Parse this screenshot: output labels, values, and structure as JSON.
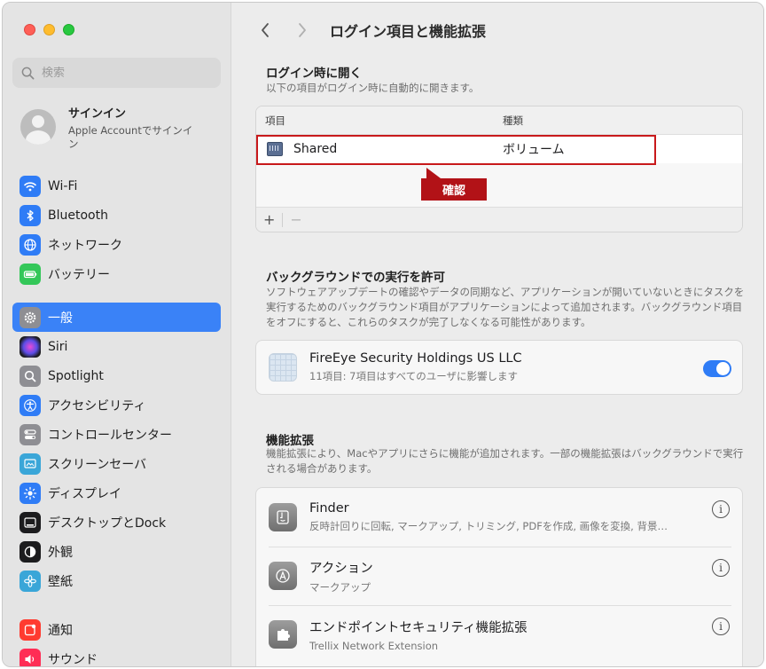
{
  "sidebar": {
    "search_placeholder": "検索",
    "account": {
      "name": "サインイン",
      "subtitle": "Apple Accountでサインイン"
    },
    "items": [
      {
        "label": "Wi-Fi",
        "icon": "wifi-icon",
        "color": "#2f7cf6"
      },
      {
        "label": "Bluetooth",
        "icon": "bluetooth-icon",
        "color": "#2f7cf6"
      },
      {
        "label": "ネットワーク",
        "icon": "globe-icon",
        "color": "#2f7cf6"
      },
      {
        "label": "バッテリー",
        "icon": "battery-icon",
        "color": "#34c759"
      },
      {
        "label": "一般",
        "icon": "gear-icon",
        "color": "#8e8e93",
        "active": true
      },
      {
        "label": "Siri",
        "icon": "siri-icon",
        "color": "#1c1c1e"
      },
      {
        "label": "Spotlight",
        "icon": "spotlight-icon",
        "color": "#8e8e93"
      },
      {
        "label": "アクセシビリティ",
        "icon": "accessibility-icon",
        "color": "#2f7cf6"
      },
      {
        "label": "コントロールセンター",
        "icon": "control-center-icon",
        "color": "#8e8e93"
      },
      {
        "label": "スクリーンセーバ",
        "icon": "screensaver-icon",
        "color": "#3aa6d8"
      },
      {
        "label": "ディスプレイ",
        "icon": "display-icon",
        "color": "#2f7cf6"
      },
      {
        "label": "デスクトップとDock",
        "icon": "dock-icon",
        "color": "#1c1c1e"
      },
      {
        "label": "外観",
        "icon": "appearance-icon",
        "color": "#1c1c1e"
      },
      {
        "label": "壁紙",
        "icon": "wallpaper-icon",
        "color": "#3aa6d8"
      },
      {
        "label": "通知",
        "icon": "notification-icon",
        "color": "#ff3b30"
      },
      {
        "label": "サウンド",
        "icon": "sound-icon",
        "color": "#ff2d55"
      }
    ]
  },
  "header": {
    "title": "ログイン項目と機能拡張"
  },
  "login": {
    "title": "ログイン時に開く",
    "desc": "以下の項目がログイン時に自動的に開きます。",
    "col_item": "項目",
    "col_kind": "種類",
    "rows": [
      {
        "name": "Shared",
        "kind": "ボリューム"
      }
    ],
    "add": "+",
    "remove": "−"
  },
  "callout": "確認",
  "background": {
    "title": "バックグラウンドでの実行を許可",
    "desc": "ソフトウェアアップデートの確認やデータの同期など、アプリケーションが開いていないときにタスクを実行するためのバックグラウンド項目がアプリケーションによって追加されます。バックグラウンド項目をオフにすると、これらのタスクが完了しなくなる可能性があります。",
    "item_name": "FireEye Security Holdings US LLC",
    "item_sub": "11項目: 7項目はすべてのユーザに影響します",
    "toggle_on": true
  },
  "extensions": {
    "title": "機能拡張",
    "desc": "機能拡張により、Macやアプリにさらに機能が追加されます。一部の機能拡張はバックグラウンドで実行される場合があります。",
    "items": [
      {
        "name": "Finder",
        "sub": "反時計回りに回転, マークアップ, トリミング, PDFを作成, 画像を変換, 背景…",
        "icon": "finder-icon"
      },
      {
        "name": "アクション",
        "sub": "マークアップ",
        "icon": "action-icon"
      },
      {
        "name": "エンドポイントセキュリティ機能拡張",
        "sub": "Trellix Network Extension",
        "icon": "puzzle-icon"
      }
    ]
  },
  "colors": {
    "accent": "#3a82f7",
    "highlight": "#c8191b",
    "callout": "#b21217"
  }
}
